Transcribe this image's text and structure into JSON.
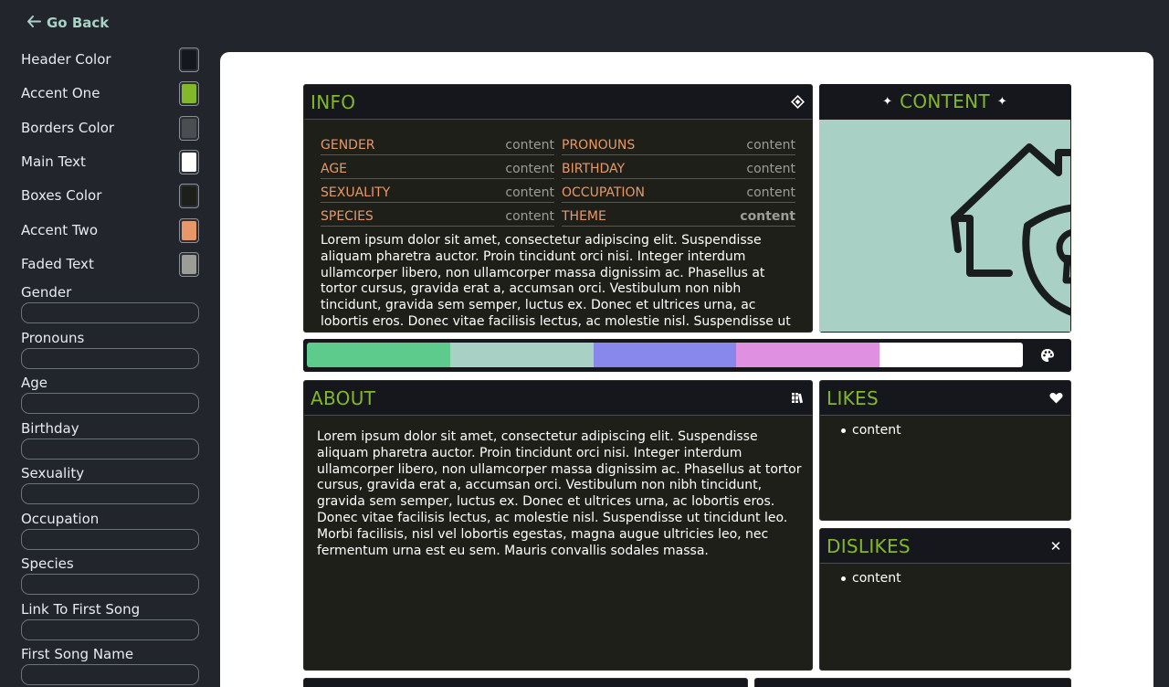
{
  "sidebar": {
    "go_back": "Go Back",
    "colors": [
      {
        "label": "Header Color",
        "color": "#15171c"
      },
      {
        "label": "Accent One",
        "color": "#82b82a"
      },
      {
        "label": "Borders Color",
        "color": "#4a4e53"
      },
      {
        "label": "Main Text",
        "color": "#ffffff"
      },
      {
        "label": "Boxes Color",
        "color": "#1f1f1a"
      },
      {
        "label": "Accent Two",
        "color": "#e89868"
      },
      {
        "label": "Faded Text",
        "color": "#9c9d97"
      }
    ],
    "fields": [
      {
        "label": "Gender",
        "value": ""
      },
      {
        "label": "Pronouns",
        "value": ""
      },
      {
        "label": "Age",
        "value": ""
      },
      {
        "label": "Birthday",
        "value": ""
      },
      {
        "label": "Sexuality",
        "value": ""
      },
      {
        "label": "Occupation",
        "value": ""
      },
      {
        "label": "Species",
        "value": ""
      },
      {
        "label": "Link To First Song",
        "value": ""
      },
      {
        "label": "First Song Name",
        "value": ""
      }
    ]
  },
  "info": {
    "title": "INFO",
    "rows_left": [
      {
        "key": "GENDER",
        "value": "content"
      },
      {
        "key": "AGE",
        "value": "content"
      },
      {
        "key": "SEXUALITY",
        "value": "content"
      },
      {
        "key": "SPECIES",
        "value": "content"
      }
    ],
    "rows_right": [
      {
        "key": "PRONOUNS",
        "value": "content"
      },
      {
        "key": "BIRTHDAY",
        "value": "content"
      },
      {
        "key": "OCCUPATION",
        "value": "content"
      },
      {
        "key": "THEME",
        "value": "content"
      }
    ],
    "text": "Lorem ipsum dolor sit amet, consectetur adipiscing elit. Suspendisse aliquam pharetra auctor. Proin tincidunt orci nisi. Integer interdum ullamcorper libero, non ullamcorper massa dignissim ac. Phasellus at tortor cursus, gravida erat a, accumsan orci. Vestibulum non nibh tincidunt, gravida sem semper, luctus ex. Donec et ultrices urna, ac lobortis eros. Donec vitae facilisis lectus, ac molestie nisl. Suspendisse ut tincidunt leo. Morbi facilisis, nisl vel lobortis egestas, magna augue ultricies leo, nec fermentum urna est eu sem."
  },
  "content_box": {
    "title": "CONTENT",
    "star": "✦",
    "image_bg": "#a8d0c4"
  },
  "palette": {
    "colors": [
      "#5ccb8c",
      "#a8d0c4",
      "#8787ec",
      "#e090e0",
      "#ffffff"
    ]
  },
  "about": {
    "title": "ABOUT",
    "text": "Lorem ipsum dolor sit amet, consectetur adipiscing elit. Suspendisse aliquam pharetra auctor. Proin tincidunt orci nisi. Integer interdum ullamcorper libero, non ullamcorper massa dignissim ac. Phasellus at tortor cursus, gravida erat a, accumsan orci. Vestibulum non nibh tincidunt, gravida sem semper, luctus ex. Donec et ultrices urna, ac lobortis eros. Donec vitae facilisis lectus, ac molestie nisl. Suspendisse ut tincidunt leo. Morbi facilisis, nisl vel lobortis egestas, magna augue ultricies leo, nec fermentum urna est eu sem. Mauris convallis sodales massa."
  },
  "likes": {
    "title": "LIKES",
    "items": [
      "content"
    ]
  },
  "dislikes": {
    "title": "DISLIKES",
    "items": [
      "content"
    ],
    "close": "✕"
  }
}
